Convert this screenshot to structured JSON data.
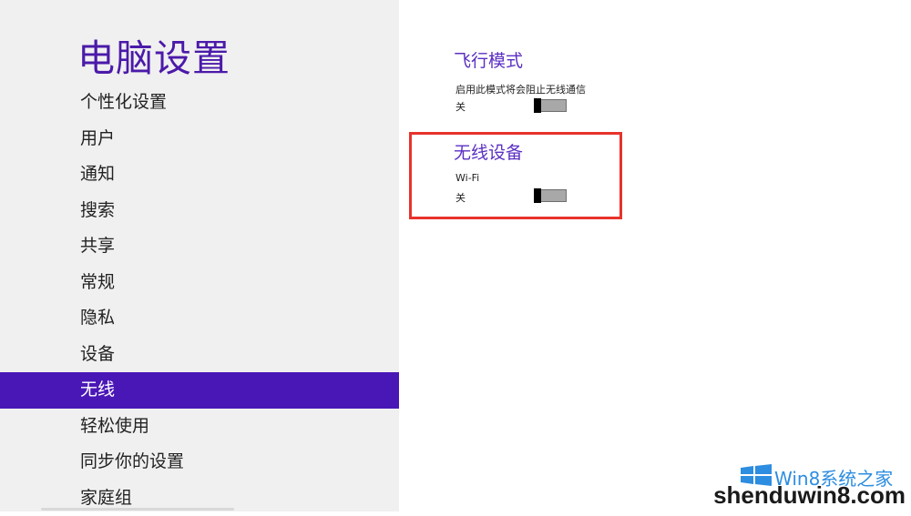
{
  "sidebar": {
    "title": "电脑设置",
    "items": [
      {
        "label": "个性化设置"
      },
      {
        "label": "用户"
      },
      {
        "label": "通知"
      },
      {
        "label": "搜索"
      },
      {
        "label": "共享"
      },
      {
        "label": "常规"
      },
      {
        "label": "隐私"
      },
      {
        "label": "设备"
      },
      {
        "label": "无线",
        "selected": true
      },
      {
        "label": "轻松使用"
      },
      {
        "label": "同步你的设置"
      },
      {
        "label": "家庭组"
      }
    ]
  },
  "airplane_mode": {
    "title": "飞行模式",
    "description": "启用此模式将会阻止无线通信",
    "state_label": "关",
    "on": false
  },
  "wireless_devices": {
    "title": "无线设备",
    "device_name": "Wi-Fi",
    "state_label": "关",
    "on": false
  },
  "watermark": {
    "top_text": "Win8系统之家",
    "bottom_text": "shenduwin8.com"
  },
  "colors": {
    "accent": "#4a17b7",
    "title": "#4b1aa9",
    "highlight_box": "#e8332b"
  }
}
